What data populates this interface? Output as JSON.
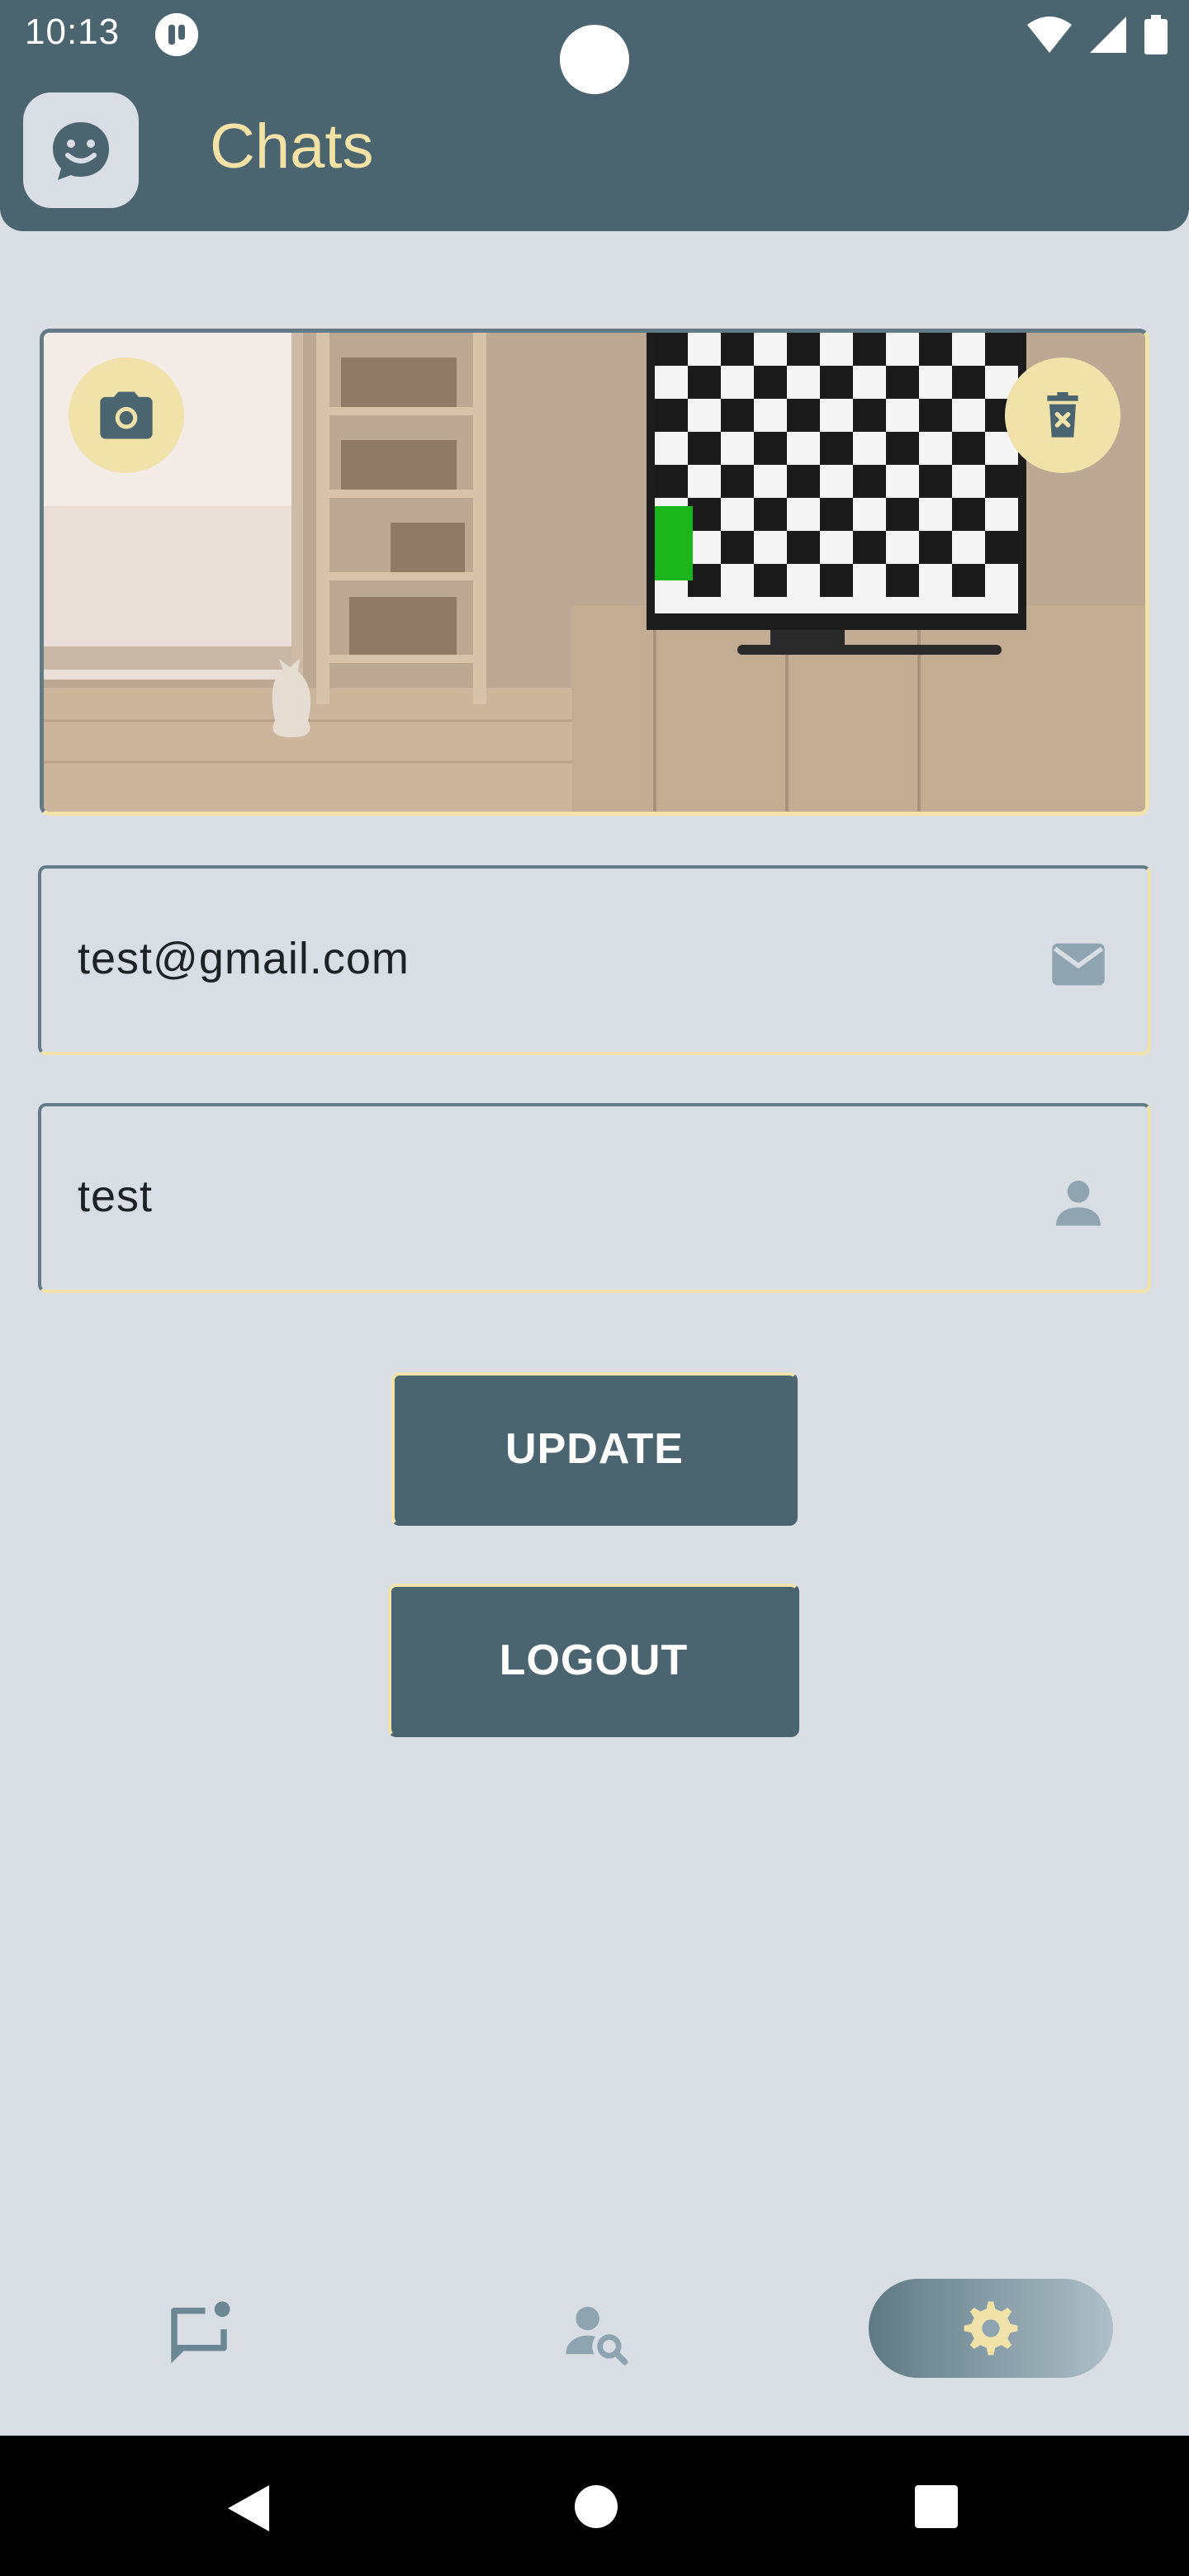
{
  "status_bar": {
    "time": "10:13"
  },
  "app_bar": {
    "title": "Chats",
    "logo_icon": "chat-smile-icon"
  },
  "image_card": {
    "camera_icon": "camera-icon",
    "delete_icon": "trash-x-icon"
  },
  "form": {
    "email": {
      "value": "test@gmail.com",
      "icon": "mail-icon"
    },
    "username": {
      "value": "test",
      "icon": "person-icon"
    }
  },
  "buttons": {
    "update": "UPDATE",
    "logout": "LOGOUT"
  },
  "bottom_nav": {
    "items": [
      {
        "name": "chats",
        "icon": "chat-notification-icon",
        "active": false
      },
      {
        "name": "search-users",
        "icon": "person-search-icon",
        "active": false
      },
      {
        "name": "settings",
        "icon": "gear-icon",
        "active": true
      }
    ]
  },
  "colors": {
    "primary": "#4a6570",
    "accent": "#f1e2a9",
    "background": "#d8dee4",
    "icon_muted": "#8ea4b0"
  }
}
